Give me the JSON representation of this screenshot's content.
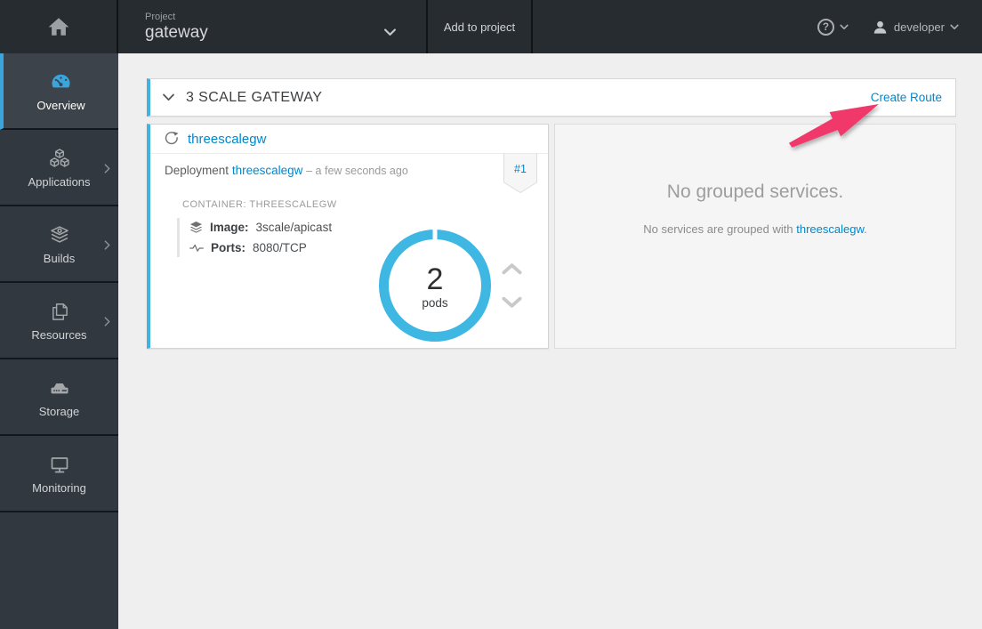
{
  "masthead": {
    "project_label": "Project",
    "project_name": "gateway",
    "add_to_project_label": "Add to project",
    "help_glyph": "?",
    "username": "developer"
  },
  "sidebar": {
    "items": [
      {
        "label": "Overview",
        "icon": "dashboard-icon",
        "active": true,
        "has_submenu": false
      },
      {
        "label": "Applications",
        "icon": "cubes-icon",
        "active": false,
        "has_submenu": true
      },
      {
        "label": "Builds",
        "icon": "builds-icon",
        "active": false,
        "has_submenu": true
      },
      {
        "label": "Resources",
        "icon": "resources-icon",
        "active": false,
        "has_submenu": true
      },
      {
        "label": "Storage",
        "icon": "storage-icon",
        "active": false,
        "has_submenu": false
      },
      {
        "label": "Monitoring",
        "icon": "monitoring-icon",
        "active": false,
        "has_submenu": false
      }
    ]
  },
  "overview": {
    "group_title": "3 SCALE GATEWAY",
    "create_route_label": "Create Route",
    "deployment_card": {
      "title_link": "threescalegw",
      "kind_label": "Deployment",
      "name_link": "threescalegw",
      "age_text": "– a few seconds ago",
      "revision_badge": "#1",
      "container_label": "CONTAINER: THREESCALEGW",
      "image_label": "Image:",
      "image_value": "3scale/apicast",
      "ports_label": "Ports:",
      "ports_value": "8080/TCP",
      "pod_count": "2",
      "pod_unit": "pods"
    },
    "services_panel": {
      "title": "No grouped services.",
      "message_prefix": "No services are grouped with ",
      "message_link": "threescalegw",
      "message_suffix": "."
    }
  },
  "colors": {
    "accent_blue": "#39a5dc",
    "link_blue": "#0088ce",
    "donut_blue": "#3eb7e3",
    "annotation_pink": "#f0386b",
    "masthead_bg": "#272c31",
    "sidebar_bg": "#313840"
  }
}
